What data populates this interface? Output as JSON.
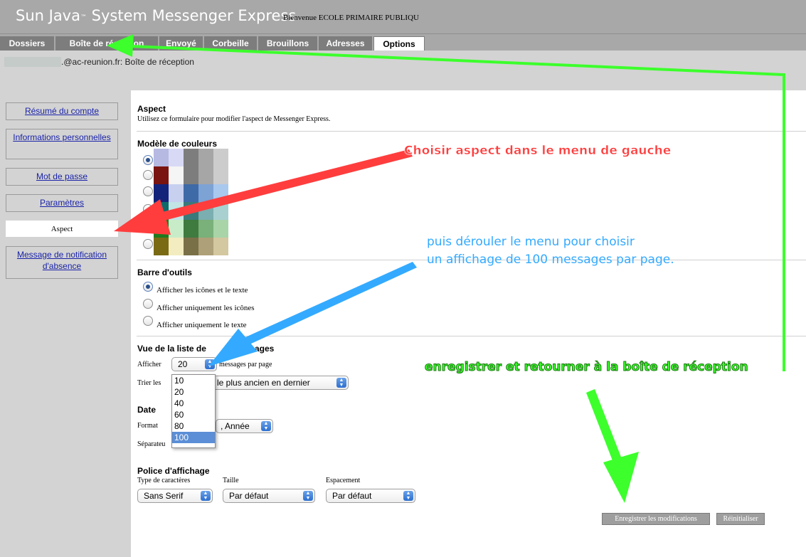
{
  "header": {
    "app_title": "Sun Java",
    "tm": "™",
    "app_title_rest": " System Messenger Express",
    "welcome": "Bienvenue ECOLE PRIMAIRE PUBLIQU"
  },
  "tabs": [
    "Dossiers",
    "Boîte de réception",
    "Envoyé",
    "Corbeille",
    "Brouillons",
    "Adresses",
    "Options"
  ],
  "active_tab": "Options",
  "breadcrumb": ".@ac-reunion.fr: Boîte de réception",
  "sidebar": {
    "items": [
      {
        "label": "Résumé du compte"
      },
      {
        "label": "Informations personnelles"
      },
      {
        "label": "Mot de passe"
      },
      {
        "label": "Paramètres"
      },
      {
        "label": "Aspect"
      },
      {
        "label": "Message de notification d'absence"
      }
    ],
    "active": "Aspect"
  },
  "aspect": {
    "title": "Aspect",
    "description": "Utilisez ce formulaire pour modifier l'aspect de Messenger Express."
  },
  "color_model": {
    "title": "Modèle de couleurs",
    "selected_index": 0,
    "palettes": [
      [
        "#b6b9e2",
        "#d8d9f5",
        "#7d7d7d",
        "#a6a6a6",
        "#cccccc"
      ],
      [
        "#7a1410",
        "#f5f5f5",
        "#7d7d7d",
        "#a6a6a6",
        "#cccccc"
      ],
      [
        "#14237a",
        "#c8d0f0",
        "#3f6aa8",
        "#7da2d4",
        "#a8c8ee"
      ],
      [
        "#0f6a6a",
        "#c2e4e4",
        "#3a7a7a",
        "#7aaeb0",
        "#a8d0d0"
      ],
      [
        "#1e7a1e",
        "#c8ecc8",
        "#3f7a3f",
        "#7ab07a",
        "#a8d4a8"
      ],
      [
        "#7a6a14",
        "#f2ecc0",
        "#7a7048",
        "#aea078",
        "#d4c8a0"
      ]
    ]
  },
  "toolbar": {
    "title": "Barre d'outils",
    "options": [
      "Afficher les icônes et le texte",
      "Afficher uniquement les icônes",
      "Afficher uniquement le texte"
    ],
    "selected_index": 0
  },
  "list_view": {
    "title": "Vue de la liste de",
    "title_rest": "ages",
    "show_label": "Afficher",
    "show_value": "20",
    "per_page_label": "messages par page",
    "sort_label": "Trier les",
    "sort_value": "le plus ancien en dernier",
    "dropdown_options": [
      "10",
      "20",
      "40",
      "60",
      "80",
      "100"
    ],
    "dropdown_highlight": "100"
  },
  "date": {
    "title": "Date",
    "format_label": "Format",
    "format_value": ", Année",
    "separator_label": "Séparateu"
  },
  "font": {
    "title": "Police d'affichage",
    "type_label": "Type de caractères",
    "type_value": "Sans Serif",
    "size_label": "Taille",
    "size_value": "Par défaut",
    "spacing_label": "Espacement",
    "spacing_value": "Par défaut"
  },
  "buttons": {
    "save": "Enregistrer les modifications",
    "reset": "Réinitialiser"
  },
  "annotations": {
    "red": "Choisir aspect dans le menu de gauche",
    "blue_line1": "puis dérouler le menu pour choisir",
    "blue_line2": "un affichage de 100 messages par page.",
    "green": "enregistrer et retourner à la boîte de réception"
  },
  "colors": {
    "header_bg": "#a8a8a8",
    "tab_bg": "#7d7d7d",
    "sidebar_bg": "#d3d3d3",
    "link": "#1a23a8",
    "annot_red": "#ff3d3d",
    "annot_blue": "#33aaff",
    "annot_green": "#3cff2c"
  }
}
